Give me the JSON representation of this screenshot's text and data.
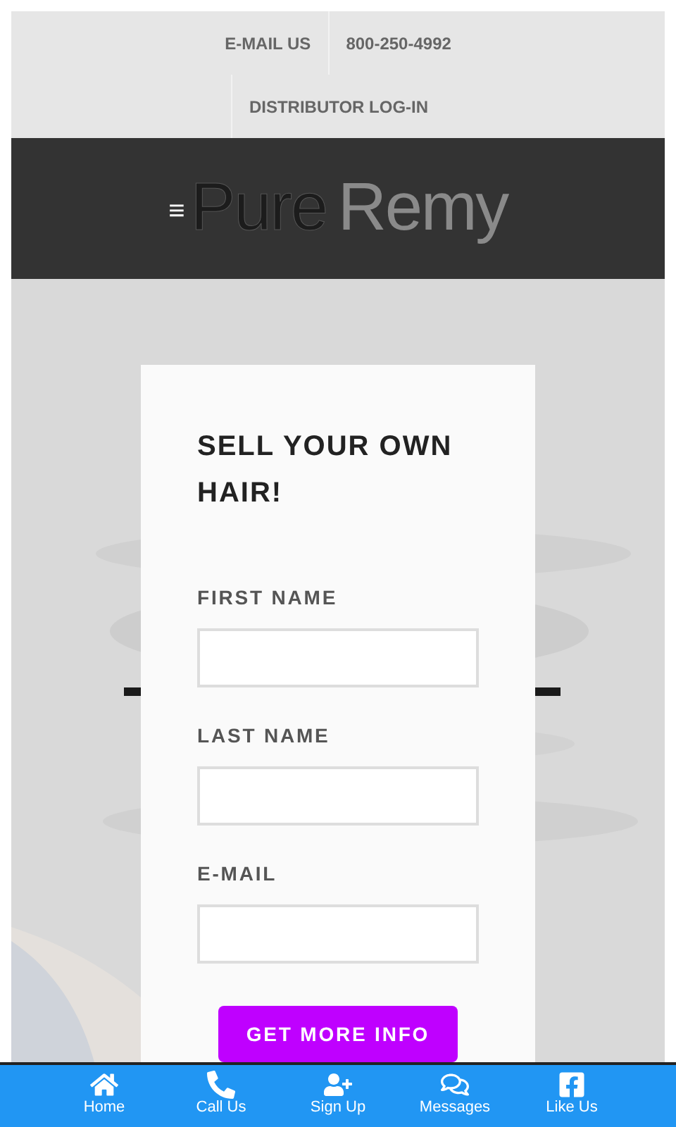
{
  "top_links": [
    {
      "label": "E-MAIL US"
    },
    {
      "label": "800-250-4992"
    },
    {
      "label": "DISTRIBUTOR LOG-IN"
    }
  ],
  "header": {
    "menu_glyph": "≡",
    "logo": [
      "Pure",
      "Remy"
    ]
  },
  "form": {
    "title": "SELL YOUR OWN HAIR!",
    "fields": [
      {
        "label": "FIRST NAME"
      },
      {
        "label": "LAST NAME"
      },
      {
        "label": "E-MAIL"
      }
    ],
    "submit": "GET MORE INFO"
  },
  "bottom_nav": [
    {
      "label": "Home",
      "kind": "home"
    },
    {
      "label": "Call Us",
      "kind": "phone"
    },
    {
      "label": "Sign Up",
      "kind": "signup"
    },
    {
      "label": "Messages",
      "kind": "chat"
    },
    {
      "label": "Like Us",
      "kind": "facebook"
    }
  ]
}
